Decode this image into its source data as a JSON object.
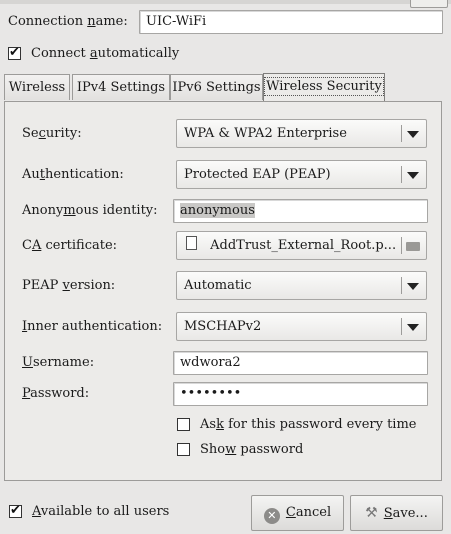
{
  "connection": {
    "name_label_pre": "Connection ",
    "name_label_u": "n",
    "name_label_post": "ame:",
    "name_value": "UIC-WiFi",
    "auto_pre": "Connect ",
    "auto_u": "a",
    "auto_post": "utomatically"
  },
  "tabs": [
    {
      "label": "Wireless"
    },
    {
      "label": "IPv4 Settings"
    },
    {
      "label": "IPv6 Settings"
    },
    {
      "label": "Wireless Security"
    }
  ],
  "security": {
    "security_label_pre": "Se",
    "security_label_u": "c",
    "security_label_post": "urity:",
    "security_value": "WPA & WPA2 Enterprise",
    "auth_label_pre": "Au",
    "auth_label_u": "t",
    "auth_label_post": "hentication:",
    "auth_value": "Protected EAP (PEAP)",
    "anon_label_pre": "Anony",
    "anon_label_u": "m",
    "anon_label_post": "ous identity:",
    "anon_value": "anonymous",
    "ca_label_pre": "C",
    "ca_label_u": "A",
    "ca_label_post": " certificate:",
    "ca_value": "AddTrust_External_Root.p...",
    "peap_label_pre": "PEAP ",
    "peap_label_u": "v",
    "peap_label_post": "ersion:",
    "peap_value": "Automatic",
    "inner_label_pre": "",
    "inner_label_u": "I",
    "inner_label_post": "nner authentication:",
    "inner_value": "MSCHAPv2",
    "user_label_pre": "",
    "user_label_u": "U",
    "user_label_post": "sername:",
    "user_value": "wdwora2",
    "pass_label_pre": "",
    "pass_label_u": "P",
    "pass_label_post": "assword:",
    "pass_value": "••••••••",
    "ask_pre": "As",
    "ask_u": "k",
    "ask_post": " for this password every time",
    "show_pre": "Sho",
    "show_u": "w",
    "show_post": " password"
  },
  "footer": {
    "available_pre": "",
    "available_u": "A",
    "available_post": "vailable to all users",
    "cancel_pre": "",
    "cancel_u": "C",
    "cancel_post": "ancel",
    "save_pre": "",
    "save_u": "S",
    "save_post": "ave..."
  },
  "icons": {
    "cancel": "cancel-icon",
    "save": "save-icon",
    "certificate": "certificate-icon",
    "folder": "folder-icon"
  }
}
